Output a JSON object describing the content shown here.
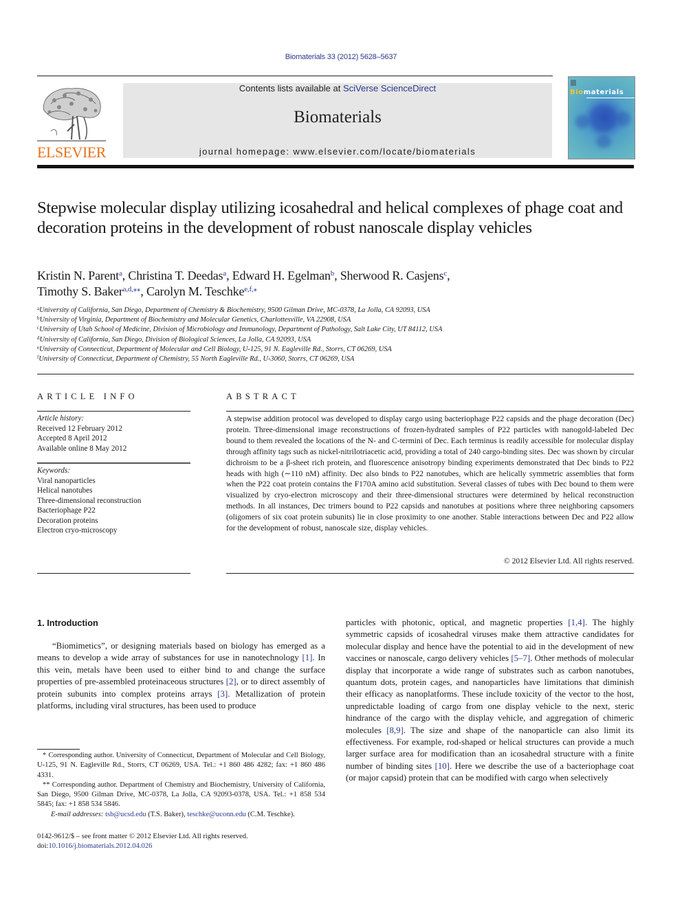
{
  "citation": "Biomaterials 33 (2012) 5628–5637",
  "banner": {
    "contents_prefix": "Contents lists available at ",
    "contents_link": "SciVerse ScienceDirect",
    "journal_name": "Biomaterials",
    "homepage": "journal homepage: www.elsevier.com/locate/biomaterials"
  },
  "publisher": {
    "wordmark": "ELSEVIER",
    "logo_icon": "elsevier-tree-icon"
  },
  "cover": {
    "title_highlight": "Bio",
    "title_rest": "materials"
  },
  "colors": {
    "link": "#2a3a8c",
    "publisher_orange": "#e9711c",
    "banner_bg": "#e6e6e6",
    "cover_highlight": "#f2c230"
  },
  "title": "Stepwise molecular display utilizing icosahedral and helical complexes of phage coat and decoration proteins in the development of robust nanoscale display vehicles",
  "authors": [
    {
      "name": "Kristin N. Parent",
      "sup": "a",
      "sep": ", "
    },
    {
      "name": "Christina T. Deedas",
      "sup": "a",
      "sep": ", "
    },
    {
      "name": "Edward H. Egelman",
      "sup": "b",
      "sep": ", "
    },
    {
      "name": "Sherwood R. Casjens",
      "sup": "c",
      "sep": ","
    },
    {
      "name": "Timothy S. Baker",
      "sup": "a,d,**",
      "sep": ", "
    },
    {
      "name": "Carolyn M. Teschke",
      "sup": "e,f,*",
      "sep": ""
    }
  ],
  "affiliations": [
    {
      "key": "a",
      "text": "University of California, San Diego, Department of Chemistry & Biochemistry, 9500 Gilman Drive, MC-0378, La Jolla, CA 92093, USA"
    },
    {
      "key": "b",
      "text": "University of Virginia, Department of Biochemistry and Molecular Genetics, Charlottesville, VA 22908, USA"
    },
    {
      "key": "c",
      "text": "University of Utah School of Medicine, Division of Microbiology and Immunology, Department of Pathology, Salt Lake City, UT 84112, USA"
    },
    {
      "key": "d",
      "text": "University of California, San Diego, Division of Biological Sciences, La Jolla, CA 92093, USA"
    },
    {
      "key": "e",
      "text": "University of Connecticut, Department of Molecular and Cell Biology, U-125, 91 N. Eagleville Rd., Storrs, CT 06269, USA"
    },
    {
      "key": "f",
      "text": "University of Connecticut, Department of Chemistry, 55 North Eagleville Rd., U-3060, Storrs, CT 06269, USA"
    }
  ],
  "article_info": {
    "heading": "ARTICLE INFO",
    "history_label": "Article history:",
    "history": [
      "Received 12 February 2012",
      "Accepted 8 April 2012",
      "Available online 8 May 2012"
    ],
    "keywords_label": "Keywords:",
    "keywords": [
      "Viral nanoparticles",
      "Helical nanotubes",
      "Three-dimensional reconstruction",
      "Bacteriophage P22",
      "Decoration proteins",
      "Electron cryo-microscopy"
    ]
  },
  "abstract": {
    "heading": "ABSTRACT",
    "text": "A stepwise addition protocol was developed to display cargo using bacteriophage P22 capsids and the phage decoration (Dec) protein. Three-dimensional image reconstructions of frozen-hydrated samples of P22 particles with nanogold-labeled Dec bound to them revealed the locations of the N- and C-termini of Dec. Each terminus is readily accessible for molecular display through affinity tags such as nickel-nitrilotriacetic acid, providing a total of 240 cargo-binding sites. Dec was shown by circular dichroism to be a β-sheet rich protein, and fluorescence anisotropy binding experiments demonstrated that Dec binds to P22 heads with high (∼110 nM) affinity. Dec also binds to P22 nanotubes, which are helically symmetric assemblies that form when the P22 coat protein contains the F170A amino acid substitution. Several classes of tubes with Dec bound to them were visualized by cryo-electron microscopy and their three-dimensional structures were determined by helical reconstruction methods. In all instances, Dec trimers bound to P22 capsids and nanotubes at positions where three neighboring capsomers (oligomers of six coat protein subunits) lie in close proximity to one another. Stable interactions between Dec and P22 allow for the development of robust, nanoscale size, display vehicles.",
    "copyright": "© 2012 Elsevier Ltd. All rights reserved."
  },
  "introduction": {
    "heading": "1.  Introduction",
    "left_column": [
      {
        "t": "“Biomimetics”, or designing materials based on biology has emerged as a means to develop a wide array of substances for use in nanotechnology "
      },
      {
        "ref": "[1]"
      },
      {
        "t": ". In this vein, metals have been used to either bind to and change the surface properties of pre-assembled proteinaceous structures "
      },
      {
        "ref": "[2]"
      },
      {
        "t": ", or to direct assembly of protein subunits into complex proteins arrays "
      },
      {
        "ref": "[3]"
      },
      {
        "t": ". Metallization of protein platforms, including viral structures, has been used to produce"
      }
    ],
    "right_column": [
      {
        "t": "particles with photonic, optical, and magnetic properties "
      },
      {
        "ref": "[1,4]"
      },
      {
        "t": ". The highly symmetric capsids of icosahedral viruses make them attractive candidates for molecular display and hence have the potential to aid in the development of new vaccines or nanoscale, cargo delivery vehicles "
      },
      {
        "ref": "[5–7]"
      },
      {
        "t": ". Other methods of molecular display that incorporate a wide range of substrates such as carbon nanotubes, quantum dots, protein cages, and nanoparticles have limitations that diminish their efficacy as nanoplatforms. These include toxicity of the vector to the host, unpredictable loading of cargo from one display vehicle to the next, steric hindrance of the cargo with the display vehicle, and aggregation of chimeric molecules "
      },
      {
        "ref": "[8,9]"
      },
      {
        "t": ". The size and shape of the nanoparticle can also limit its effectiveness. For example, rod-shaped or helical structures can provide a much larger surface area for modification than an icosahedral structure with a finite number of binding sites "
      },
      {
        "ref": "[10]"
      },
      {
        "t": ". Here we describe the use of a bacteriophage coat (or major capsid) protein that can be modified with cargo when selectively"
      }
    ]
  },
  "footnotes": {
    "fn1": "* Corresponding author. University of Connecticut, Department of Molecular and Cell Biology, U-125, 91 N. Eagleville Rd., Storrs, CT 06269, USA. Tel.: +1 860 486 4282; fax: +1 860 486 4331.",
    "fn2": "** Corresponding author. Department of Chemistry and Biochemistry, University of California, San Diego, 9500 Gilman Drive, MC-0378, La Jolla, CA 92093-0378, USA. Tel.: +1 858 534 5845; fax: +1 858 534 5846.",
    "email_label": "E-mail addresses: ",
    "email1": "tsb@ucsd.edu",
    "email1_who": " (T.S. Baker), ",
    "email2": "teschke@uconn.edu",
    "email2_who": " (C.M. Teschke).",
    "issn_line": "0142-9612/$ – see front matter © 2012 Elsevier Ltd. All rights reserved.",
    "doi_prefix": "doi:",
    "doi": "10.1016/j.biomaterials.2012.04.026"
  }
}
